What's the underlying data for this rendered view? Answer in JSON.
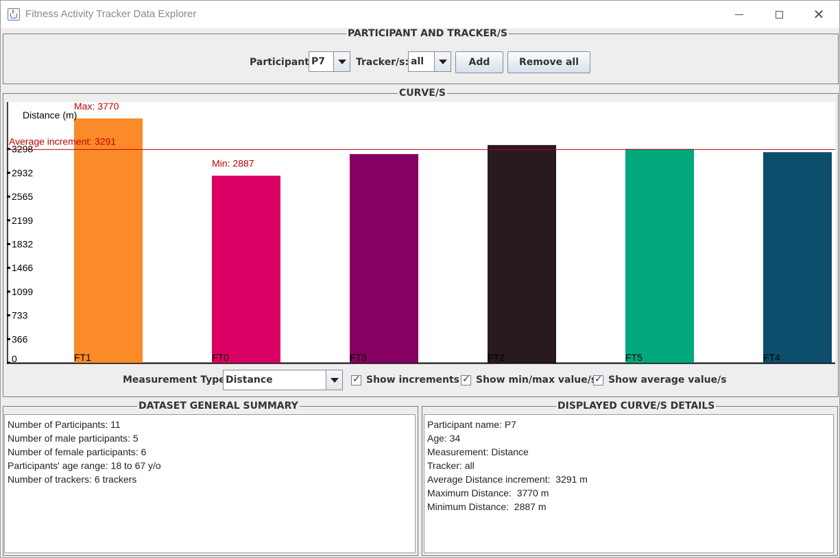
{
  "window": {
    "title": "Fitness Activity Tracker Data Explorer"
  },
  "participant_panel": {
    "title": "PARTICIPANT AND TRACKER/S",
    "participant_label": "Participant:",
    "participant_value": "P7",
    "tracker_label": "Tracker/s:",
    "tracker_value": "all",
    "add_label": "Add",
    "remove_all_label": "Remove all"
  },
  "curves_panel": {
    "title": "CURVE/S",
    "measurement_label": "Measurement Type:",
    "measurement_value": "Distance",
    "show_increments_label": "Show increments",
    "show_minmax_label": "Show min/max value/s",
    "show_average_label": "Show average value/s",
    "show_increments_checked": true,
    "show_minmax_checked": true,
    "show_average_checked": true
  },
  "chart_data": {
    "type": "bar",
    "ylabel": "Distance (m)",
    "xlabel": "",
    "title": "",
    "categories": [
      "FT1",
      "FT0",
      "FT3",
      "FT2",
      "FT5",
      "FT4"
    ],
    "values": [
      3770,
      2887,
      3220,
      3360,
      3300,
      3250
    ],
    "colors": [
      "#fb8a28",
      "#db0064",
      "#850060",
      "#291921",
      "#03a97c",
      "#0c4e6b"
    ],
    "ylim": [
      0,
      3770
    ],
    "yticks": [
      0,
      366,
      733,
      1099,
      1466,
      1832,
      2199,
      2565,
      2932,
      3298
    ],
    "annotations": {
      "max_label": "Max: 3770",
      "min_label": "Min: 2887",
      "average_label": "Average increment: 3291",
      "average_value": 3291,
      "annotation_color": "#c00000"
    },
    "grid": false
  },
  "summary_panel": {
    "title": "DATASET GENERAL SUMMARY",
    "lines": [
      "Number of Participants: 11",
      "Number of male participants: 5",
      "Number of female participants: 6",
      "Participants' age range: 18 to 67 y/o",
      "Number of trackers: 6 trackers"
    ]
  },
  "details_panel": {
    "title": "DISPLAYED CURVE/S DETAILS",
    "lines": [
      "Participant name: P7",
      "Age: 34",
      "Measurement: Distance",
      "Tracker: all",
      "Average Distance increment:  3291 m",
      "Maximum Distance:  3770 m",
      "Minimum Distance:  2887 m"
    ]
  }
}
